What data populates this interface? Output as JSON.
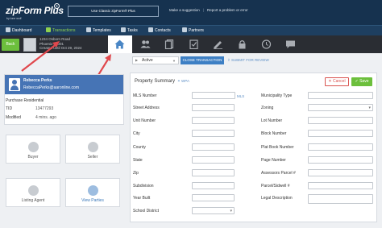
{
  "topbar": {
    "logo": "zipForm Plus",
    "logo_sub": "by lone wolf",
    "classic_button": "Use Classic zipForm® Plus",
    "link_suggestion": "Make a suggestion",
    "link_report": "Report a problem or error"
  },
  "nav": {
    "items": [
      {
        "label": "Dashboard",
        "icon": "dashboard-icon"
      },
      {
        "label": "Transactions",
        "icon": "transactions-icon"
      },
      {
        "label": "Templates",
        "icon": "templates-icon"
      },
      {
        "label": "Tasks",
        "icon": "tasks-icon"
      },
      {
        "label": "Contacts",
        "icon": "contacts-icon"
      },
      {
        "label": "Partners",
        "icon": "partners-icon"
      }
    ],
    "active_color": "#8fd14f"
  },
  "header": {
    "back_label": "Back",
    "address_line1": "1234 Osborn Road",
    "address_line2": "Phoenix 85001",
    "address_line3": "Created until Oct 29, 2024"
  },
  "contact": {
    "name": "Rebecca Perks",
    "email": "RebeccaPerks@aaronline.com",
    "type": "Purchase Residential",
    "tid_label": "TID",
    "tid_value": "13477293",
    "modified_label": "Modified",
    "modified_value": "4 mins. ago"
  },
  "parties": {
    "buyer": "Buyer",
    "seller": "Seller",
    "listing_agent": "Listing Agent",
    "view_parties": "View Parties"
  },
  "actions": {
    "status": "Active",
    "close_transaction": "CLOSE TRANSACTION",
    "submit_review": "SUBMIT FOR REVIEW"
  },
  "form": {
    "title": "Property Summary",
    "wpa_label": "WPA",
    "cancel_label": "Cancel",
    "save_label": "Save",
    "mls_link": "MLS",
    "left_fields": [
      "MLS Number",
      "Street Address",
      "Unit Number",
      "City",
      "County",
      "State",
      "Zip",
      "Subdivision",
      "Year Built",
      "School District"
    ],
    "right_fields": [
      "Municipality Type",
      "Zoning",
      "Lot Number",
      "Block Number",
      "Plat Book Number",
      "Page Number",
      "Assessors Parcel #",
      "Parcel/Sidwell #",
      "Legal Description"
    ]
  },
  "colors": {
    "topbar": "#16324f",
    "nav": "#1e3f60",
    "header": "#2a2d33",
    "accent_green": "#6cbf3c",
    "accent_blue": "#3d7fc4",
    "contact_blue": "#4674b5",
    "arrow_red": "#e0474c"
  }
}
